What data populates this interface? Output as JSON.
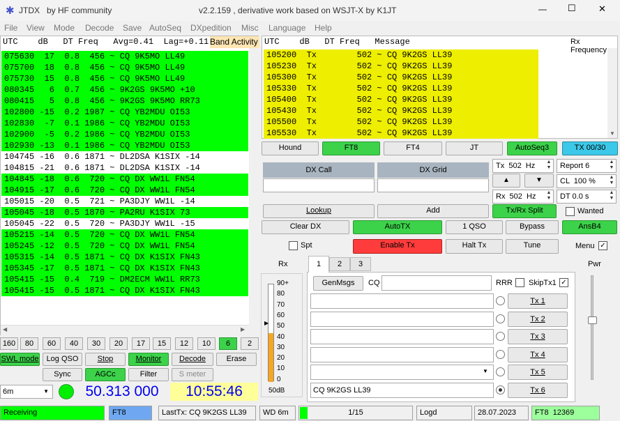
{
  "window": {
    "app_title": "JTDX   by HF community",
    "center_title": "v2.2.159 , derivative work based on WSJT-X by K1JT",
    "controls": [
      "—",
      "☐",
      "✕"
    ]
  },
  "menu": [
    "File",
    "View",
    "Mode",
    "Decode",
    "Save",
    "AutoSeq",
    "DXpedition",
    "Misc",
    "Language",
    "Help"
  ],
  "band_activity": {
    "header": "UTC    dB   DT Freq   Avg=0.41  Lag=+0.11",
    "title": "Band Activity",
    "rows": [
      {
        "text": "075630  17  0.8  456 ~ CQ 9K5MO LL49",
        "bg": "green"
      },
      {
        "text": "075700  18  0.8  456 ~ CQ 9K5MO LL49",
        "bg": "green"
      },
      {
        "text": "075730  15  0.8  456 ~ CQ 9K5MO LL49",
        "bg": "green"
      },
      {
        "text": "080345   6  0.7  456 ~ 9K2GS 9K5MO +10",
        "bg": "green"
      },
      {
        "text": "080415   5  0.8  456 ~ 9K2GS 9K5MO RR73",
        "bg": "green"
      },
      {
        "text": "102800 -15  0.2 1987 ~ CQ YB2MDU OI53",
        "bg": "green"
      },
      {
        "text": "102830  -7  0.1 1986 ~ CQ YB2MDU OI53",
        "bg": "green"
      },
      {
        "text": "102900  -5  0.2 1986 ~ CQ YB2MDU OI53",
        "bg": "green"
      },
      {
        "text": "102930 -13  0.1 1986 ~ CQ YB2MDU OI53",
        "bg": "green"
      },
      {
        "text": "104745 -16  0.6 1871 ~ DL2DSA K1SIX -14",
        "bg": "white"
      },
      {
        "text": "104815 -21  0.6 1871 ~ DL2DSA K1SIX -14",
        "bg": "white"
      },
      {
        "text": "104845 -18  0.6  720 ~ CQ DX WW1L FN54",
        "bg": "green"
      },
      {
        "text": "104915 -17  0.6  720 ~ CQ DX WW1L FN54",
        "bg": "green"
      },
      {
        "text": "105015 -20  0.5  721 ~ PA3DJY WW1L -14",
        "bg": "white"
      },
      {
        "text": "105045 -18  0.5 1870 ~ PA2RU K1SIX 73",
        "bg": "green"
      },
      {
        "text": "105045 -22  0.5  720 ~ PA3DJY WW1L -15",
        "bg": "white"
      },
      {
        "text": "105215 -14  0.5  720 ~ CQ DX WW1L FN54",
        "bg": "green"
      },
      {
        "text": "105245 -12  0.5  720 ~ CQ DX WW1L FN54",
        "bg": "green"
      },
      {
        "text": "105315 -14  0.5 1871 ~ CQ DX K1SIX FN43",
        "bg": "green"
      },
      {
        "text": "105345 -17  0.5 1871 ~ CQ DX K1SIX FN43",
        "bg": "green"
      },
      {
        "text": "105415 -15  0.4  719 ~ DM2ECM WW1L RR73",
        "bg": "green"
      },
      {
        "text": "105415 -15  0.5 1871 ~ CQ DX K1SIX FN43",
        "bg": "green"
      }
    ]
  },
  "rx_frequency": {
    "header": "UTC    dB   DT Freq   Message",
    "title": "Rx Frequency",
    "rows": [
      "105200  Tx        502 ~ CQ 9K2GS LL39",
      "105230  Tx        502 ~ CQ 9K2GS LL39",
      "105300  Tx        502 ~ CQ 9K2GS LL39",
      "105330  Tx        502 ~ CQ 9K2GS LL39",
      "105400  Tx        502 ~ CQ 9K2GS LL39",
      "105430  Tx        502 ~ CQ 9K2GS LL39",
      "105500  Tx        502 ~ CQ 9K2GS LL39",
      "105530  Tx        502 ~ CQ 9K2GS LL39"
    ]
  },
  "bands": [
    "160",
    "80",
    "60",
    "40",
    "30",
    "20",
    "17",
    "15",
    "12",
    "10",
    "6",
    "2"
  ],
  "active_band": "6",
  "left_buttons": {
    "swl_mode": "SWL mode",
    "log_qso": "Log QSO",
    "stop": "Stop",
    "monitor": "Monitor",
    "decode": "Decode",
    "erase": "Erase",
    "sync": "Sync",
    "agcc": "AGCc",
    "filter": "Filter",
    "s_meter": "S meter"
  },
  "band_select": "6m",
  "frequency": "50.313 000",
  "clock": "10:55:46",
  "mode_buttons": {
    "hound": "Hound",
    "ft8": "FT8",
    "ft4": "FT4",
    "jt": "JT",
    "autoseq": "AutoSeq3",
    "tx": "TX 00/30"
  },
  "dx": {
    "call_label": "DX Call",
    "grid_label": "DX Grid",
    "call_value": "",
    "grid_value": ""
  },
  "tx_freq": "Tx  502  Hz",
  "rx_freq": "Rx  502  Hz",
  "report": "Report 6",
  "cl": "CL  100 %",
  "dt": "DT 0.0 s",
  "buttons": {
    "lookup": "Lookup",
    "add": "Add",
    "txrx_split": "Tx/Rx Split",
    "wanted": "Wanted",
    "clear_dx": "Clear DX",
    "autotx": "AutoTX",
    "one_qso": "1 QSO",
    "bypass": "Bypass",
    "ansb4": "AnsB4",
    "spt": "Spt",
    "enable_tx": "Enable Tx",
    "halt_tx": "Halt Tx",
    "tune": "Tune",
    "menu": "Menu"
  },
  "rx_meter": {
    "label": "Rx",
    "scale": [
      "90+",
      "80",
      "70",
      "60",
      "50",
      "40",
      "30",
      "20",
      "10",
      "0"
    ],
    "value_label": "50dB",
    "level": 50
  },
  "tabs": [
    "1",
    "2",
    "3"
  ],
  "gen": {
    "genmsgs": "GenMsgs",
    "cq_label": "CQ",
    "cq_value": "",
    "rrr": "RRR",
    "skiptx1": "SkipTx1"
  },
  "tx_messages": [
    "",
    "",
    "",
    "",
    "",
    "CQ 9K2GS LL39"
  ],
  "tx_buttons": [
    "Tx 1",
    "Tx 2",
    "Tx 3",
    "Tx 4",
    "Tx 5",
    "Tx 6"
  ],
  "pwr_label": "Pwr",
  "statusbar": {
    "receiving": "Receiving",
    "mode": "FT8",
    "lasttx": "LastTx: CQ 9K2GS LL39",
    "wd": "WD 6m",
    "progress": "1/15",
    "logd": "Logd",
    "date": "28.07.2023",
    "mode_count": "FT8  12369"
  },
  "colors": {
    "green": "#00ff00",
    "yellow": "#eeee00",
    "blue_freq": "#0000ee",
    "clock_bg": "#ffff99",
    "active_btn": "#3cd24a",
    "halt": "#ff3c3c"
  }
}
